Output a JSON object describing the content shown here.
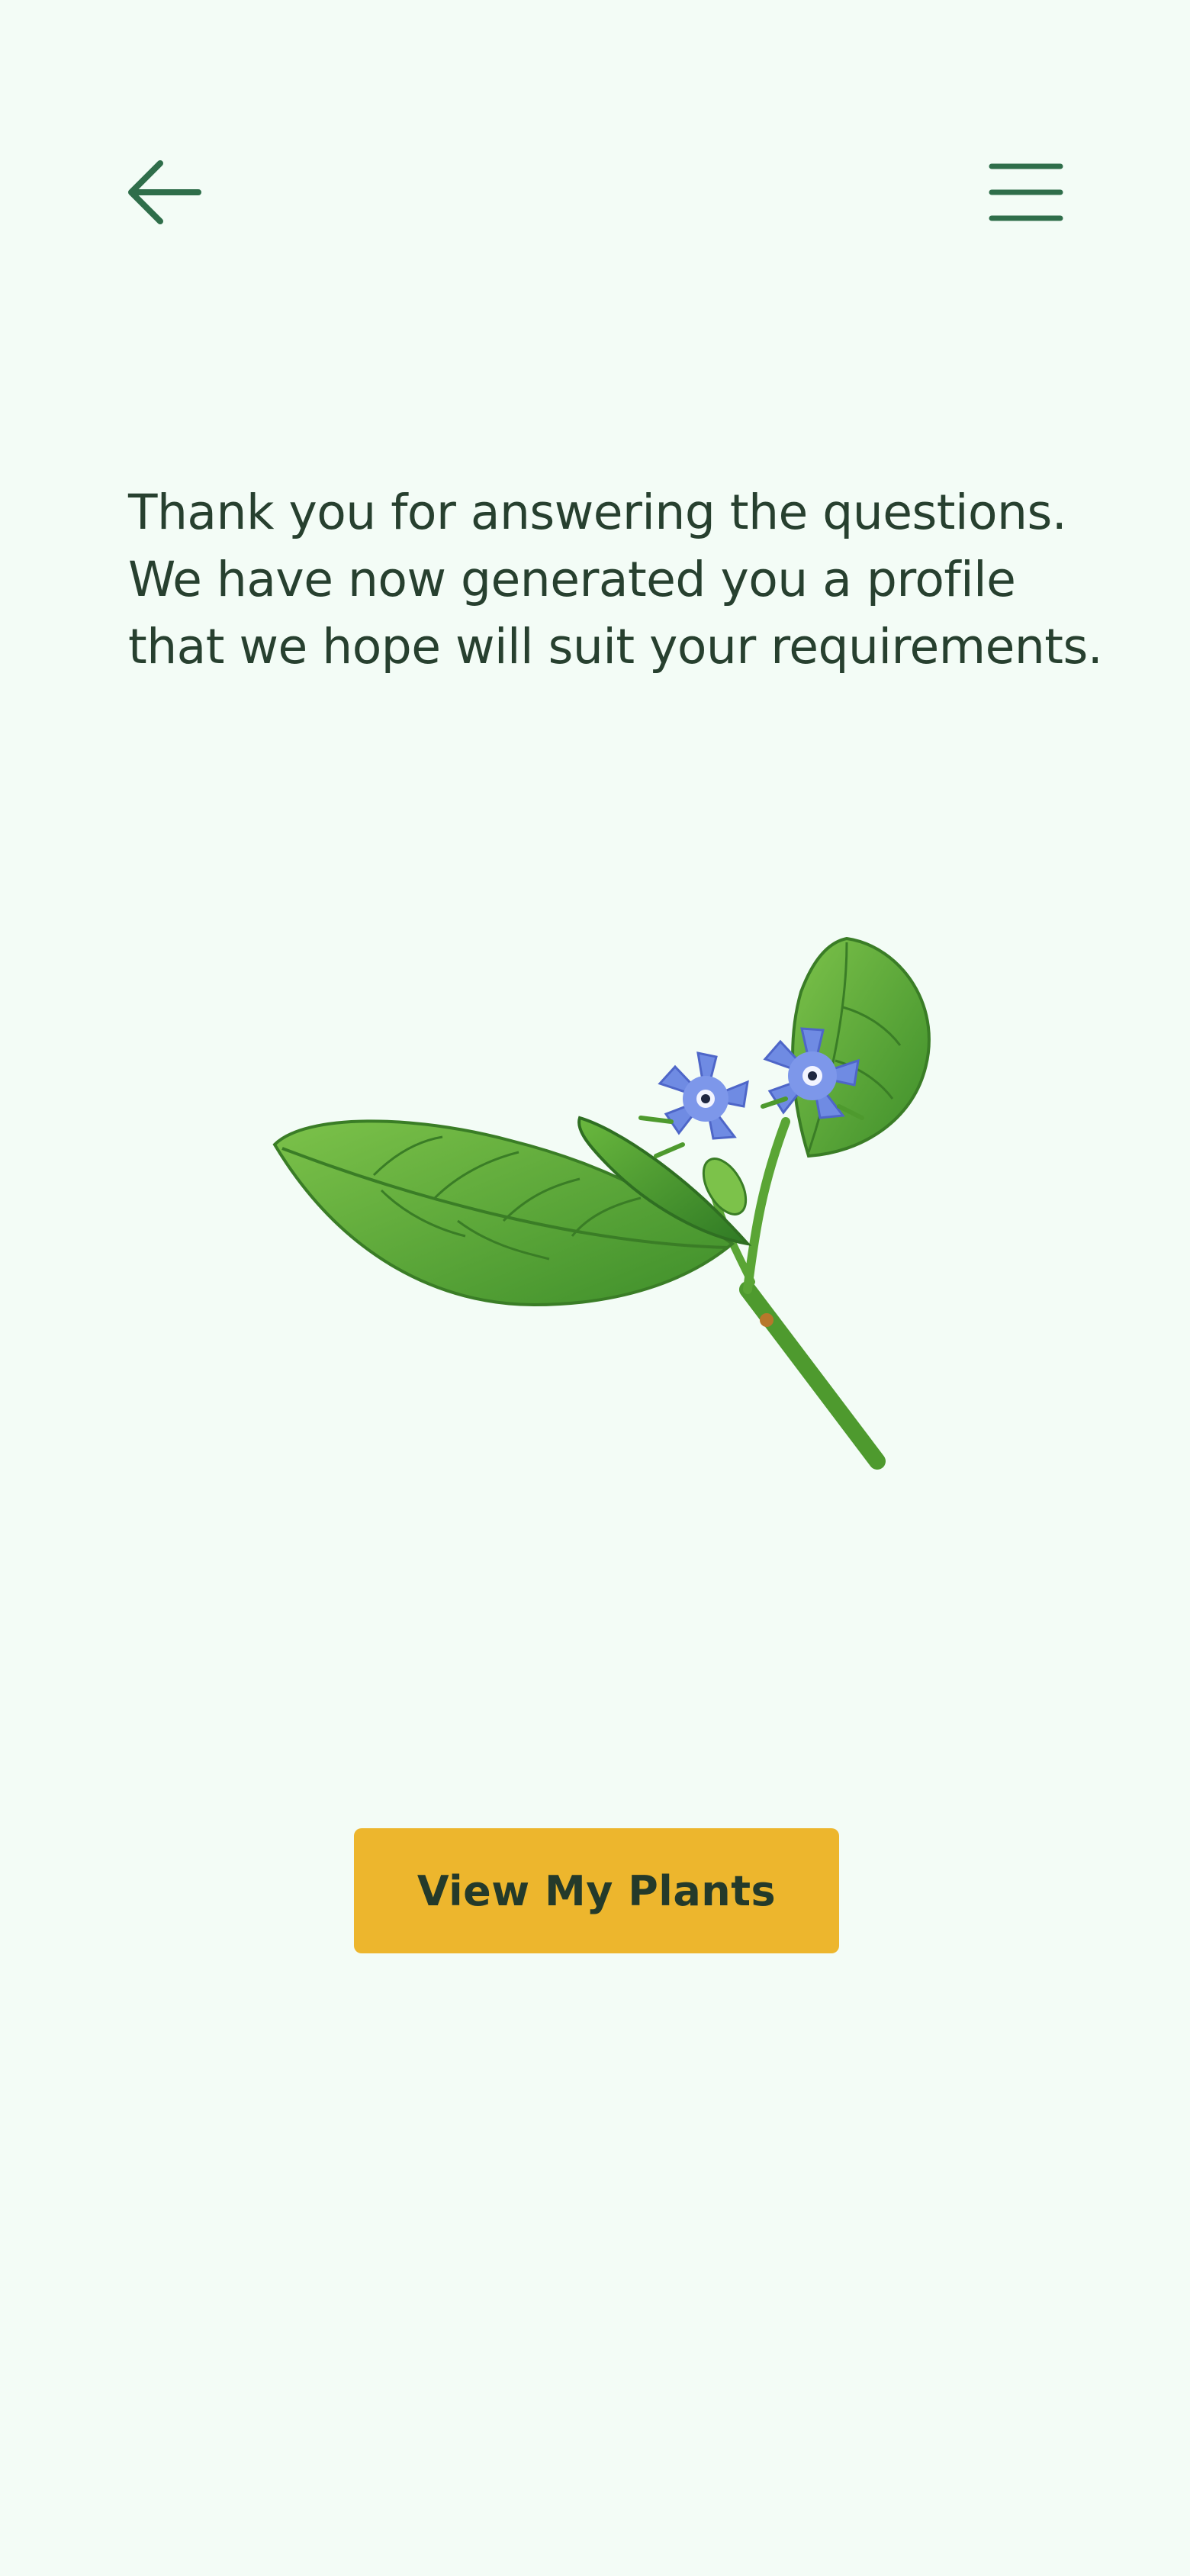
{
  "header": {
    "back_icon": "arrow-left-icon",
    "menu_icon": "hamburger-menu-icon",
    "icon_color": "#2F6E4A"
  },
  "main": {
    "message_line_1": "Thank you for answering the questions.",
    "message_line_2": "We have now generated you a profile",
    "message_line_3": "that we hope will suit your requirements.",
    "illustration": "borage-plant-illustration",
    "cta_label": "View My Plants"
  },
  "colors": {
    "background": "#F3FCF6",
    "text": "#27402F",
    "button": "#EDB62D",
    "button_text": "#243A2A"
  }
}
